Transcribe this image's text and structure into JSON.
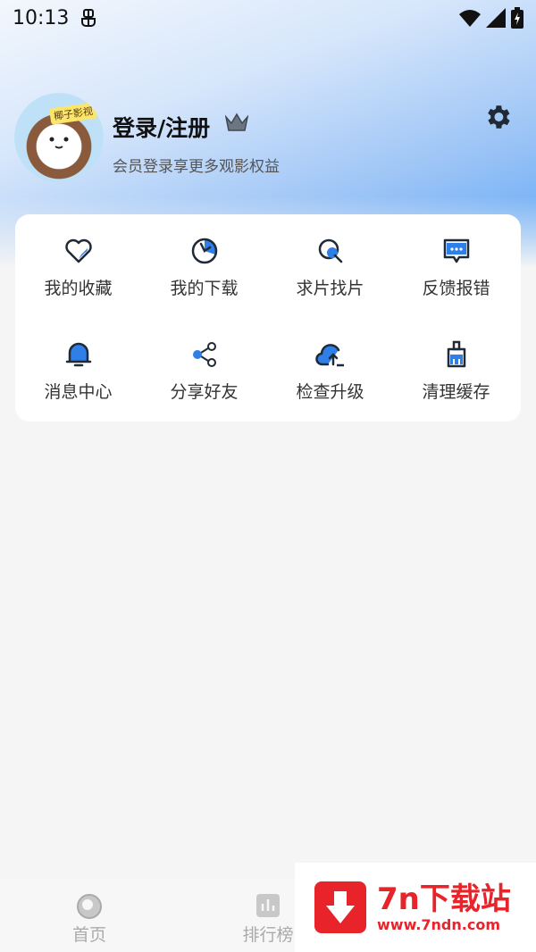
{
  "status_bar": {
    "time": "10:13",
    "notification_icon": "bug-icon",
    "icons": [
      "wifi-icon",
      "signal-icon",
      "battery-icon"
    ]
  },
  "profile": {
    "avatar_label": "椰子影视",
    "login_label": "登录/注册",
    "member_tip": "会员登录享更多观影权益",
    "crown_icon": "crown-icon",
    "settings_icon": "gear-icon"
  },
  "menu": {
    "items": [
      {
        "label": "我的收藏",
        "icon": "heart-icon"
      },
      {
        "label": "我的下载",
        "icon": "download-icon"
      },
      {
        "label": "求片找片",
        "icon": "search-icon"
      },
      {
        "label": "反馈报错",
        "icon": "feedback-icon"
      },
      {
        "label": "消息中心",
        "icon": "bell-icon"
      },
      {
        "label": "分享好友",
        "icon": "share-icon"
      },
      {
        "label": "检查升级",
        "icon": "upgrade-icon"
      },
      {
        "label": "清理缓存",
        "icon": "broom-icon"
      }
    ]
  },
  "bottom_nav": {
    "items": [
      {
        "label": "首页",
        "icon": "home-icon"
      },
      {
        "label": "排行榜",
        "icon": "chart-icon"
      }
    ]
  },
  "watermark": {
    "title": "7n下载站",
    "url": "www.7ndn.com"
  },
  "colors": {
    "accent": "#2f7fe8",
    "icon_stroke": "#1f2a36",
    "watermark": "#e8242a"
  }
}
